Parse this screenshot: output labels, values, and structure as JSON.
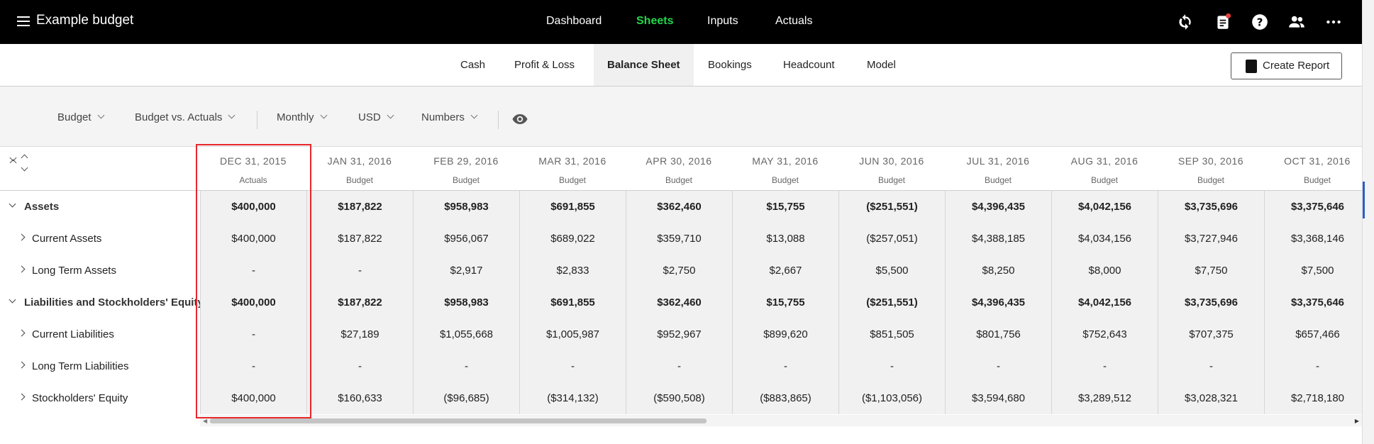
{
  "app": {
    "title": "Example budget"
  },
  "nav": {
    "items": [
      "Dashboard",
      "Sheets",
      "Inputs",
      "Actuals"
    ],
    "active": "Sheets"
  },
  "tabs": {
    "items": [
      "Cash",
      "Profit & Loss",
      "Balance Sheet",
      "Bookings",
      "Headcount",
      "Model"
    ],
    "active": "Balance Sheet"
  },
  "create_report": {
    "label": "Create Report"
  },
  "filters": [
    {
      "label": "Budget"
    },
    {
      "label": "Budget vs. Actuals"
    },
    {
      "label": "Monthly"
    },
    {
      "label": "USD"
    },
    {
      "label": "Numbers"
    }
  ],
  "columns": [
    {
      "date": "DEC 31, 2015",
      "kind": "Actuals"
    },
    {
      "date": "JAN 31, 2016",
      "kind": "Budget"
    },
    {
      "date": "FEB 29, 2016",
      "kind": "Budget"
    },
    {
      "date": "MAR 31, 2016",
      "kind": "Budget"
    },
    {
      "date": "APR 30, 2016",
      "kind": "Budget"
    },
    {
      "date": "MAY 31, 2016",
      "kind": "Budget"
    },
    {
      "date": "JUN 30, 2016",
      "kind": "Budget"
    },
    {
      "date": "JUL 31, 2016",
      "kind": "Budget"
    },
    {
      "date": "AUG 31, 2016",
      "kind": "Budget"
    },
    {
      "date": "SEP 30, 2016",
      "kind": "Budget"
    },
    {
      "date": "OCT 31, 2016",
      "kind": "Budget"
    }
  ],
  "rows": [
    {
      "label": "Assets",
      "level": 0,
      "bold": true,
      "values": [
        "$400,000",
        "$187,822",
        "$958,983",
        "$691,855",
        "$362,460",
        "$15,755",
        "($251,551)",
        "$4,396,435",
        "$4,042,156",
        "$3,735,696",
        "$3,375,646"
      ]
    },
    {
      "label": "Current Assets",
      "level": 1,
      "bold": false,
      "values": [
        "$400,000",
        "$187,822",
        "$956,067",
        "$689,022",
        "$359,710",
        "$13,088",
        "($257,051)",
        "$4,388,185",
        "$4,034,156",
        "$3,727,946",
        "$3,368,146"
      ]
    },
    {
      "label": "Long Term Assets",
      "level": 1,
      "bold": false,
      "values": [
        "-",
        "-",
        "$2,917",
        "$2,833",
        "$2,750",
        "$2,667",
        "$5,500",
        "$8,250",
        "$8,000",
        "$7,750",
        "$7,500"
      ]
    },
    {
      "label": "Liabilities and Stockholders' Equity",
      "level": 0,
      "bold": true,
      "values": [
        "$400,000",
        "$187,822",
        "$958,983",
        "$691,855",
        "$362,460",
        "$15,755",
        "($251,551)",
        "$4,396,435",
        "$4,042,156",
        "$3,735,696",
        "$3,375,646"
      ]
    },
    {
      "label": "Current Liabilities",
      "level": 1,
      "bold": false,
      "values": [
        "-",
        "$27,189",
        "$1,055,668",
        "$1,005,987",
        "$952,967",
        "$899,620",
        "$851,505",
        "$801,756",
        "$752,643",
        "$707,375",
        "$657,466"
      ]
    },
    {
      "label": "Long Term Liabilities",
      "level": 1,
      "bold": false,
      "values": [
        "-",
        "-",
        "-",
        "-",
        "-",
        "-",
        "-",
        "-",
        "-",
        "-",
        "-"
      ]
    },
    {
      "label": "Stockholders' Equity",
      "level": 1,
      "bold": false,
      "values": [
        "$400,000",
        "$160,633",
        "($96,685)",
        "($314,132)",
        "($590,508)",
        "($883,865)",
        "($1,103,056)",
        "$3,594,680",
        "$3,289,512",
        "$3,028,321",
        "$2,718,180"
      ]
    }
  ],
  "colors": {
    "active_nav": "#22d64c",
    "highlight_border": "#e8262b"
  }
}
